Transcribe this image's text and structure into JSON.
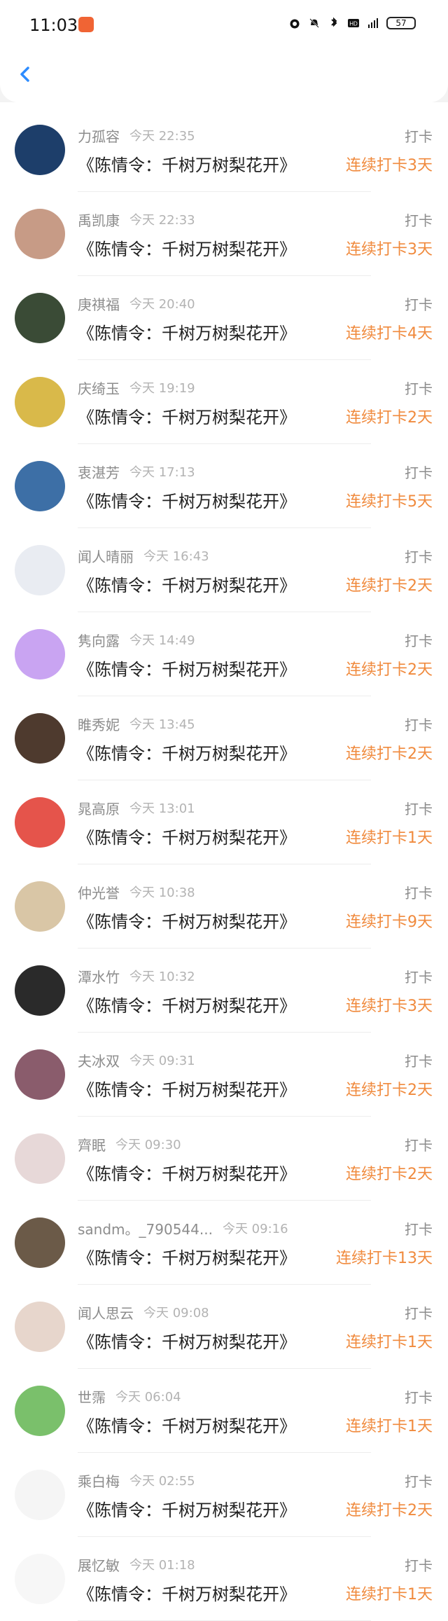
{
  "status_bar": {
    "time": "11:03",
    "battery": "57",
    "icons": [
      "alarm-icon",
      "bell-off-icon",
      "bluetooth-icon",
      "hd-icon",
      "5g-signal-icon",
      "battery-icon"
    ]
  },
  "nav": {
    "back_icon": "back-chevron-icon"
  },
  "rows": [
    {
      "name": "力孤容",
      "time": "今天 22:35",
      "title": "《陈情令：千树万树梨花开》",
      "action": "打卡",
      "streak": "连续打卡3天",
      "avatar_color": "#1d3e6a"
    },
    {
      "name": "禹凯康",
      "time": "今天 22:33",
      "title": "《陈情令：千树万树梨花开》",
      "action": "打卡",
      "streak": "连续打卡3天",
      "avatar_color": "#c79b86"
    },
    {
      "name": "庚祺福",
      "time": "今天 20:40",
      "title": "《陈情令：千树万树梨花开》",
      "action": "打卡",
      "streak": "连续打卡4天",
      "avatar_color": "#3a4b36"
    },
    {
      "name": "庆绮玉",
      "time": "今天 19:19",
      "title": "《陈情令：千树万树梨花开》",
      "action": "打卡",
      "streak": "连续打卡2天",
      "avatar_color": "#d9b94a"
    },
    {
      "name": "衷湛芳",
      "time": "今天 17:13",
      "title": "《陈情令：千树万树梨花开》",
      "action": "打卡",
      "streak": "连续打卡5天",
      "avatar_color": "#3d6fa6"
    },
    {
      "name": "闻人晴丽",
      "time": "今天 16:43",
      "title": "《陈情令：千树万树梨花开》",
      "action": "打卡",
      "streak": "连续打卡2天",
      "avatar_color": "#e9ecf2"
    },
    {
      "name": "隽向露",
      "time": "今天 14:49",
      "title": "《陈情令：千树万树梨花开》",
      "action": "打卡",
      "streak": "连续打卡2天",
      "avatar_color": "#c9a4f2"
    },
    {
      "name": "睢秀妮",
      "time": "今天 13:45",
      "title": "《陈情令：千树万树梨花开》",
      "action": "打卡",
      "streak": "连续打卡2天",
      "avatar_color": "#4e3a2e"
    },
    {
      "name": "晁高原",
      "time": "今天 13:01",
      "title": "《陈情令：千树万树梨花开》",
      "action": "打卡",
      "streak": "连续打卡1天",
      "avatar_color": "#e5544b"
    },
    {
      "name": "仲光誉",
      "time": "今天 10:38",
      "title": "《陈情令：千树万树梨花开》",
      "action": "打卡",
      "streak": "连续打卡9天",
      "avatar_color": "#d9c6a6"
    },
    {
      "name": "潭水竹",
      "time": "今天 10:32",
      "title": "《陈情令：千树万树梨花开》",
      "action": "打卡",
      "streak": "连续打卡3天",
      "avatar_color": "#2a2a2a"
    },
    {
      "name": "夫冰双",
      "time": "今天 09:31",
      "title": "《陈情令：千树万树梨花开》",
      "action": "打卡",
      "streak": "连续打卡2天",
      "avatar_color": "#8a5c6c"
    },
    {
      "name": "齊眠",
      "time": "今天 09:30",
      "title": "《陈情令：千树万树梨花开》",
      "action": "打卡",
      "streak": "连续打卡2天",
      "avatar_color": "#e7d8d8"
    },
    {
      "name": "sandm。_790544...",
      "time": "今天 09:16",
      "title": "《陈情令：千树万树梨花开》",
      "action": "打卡",
      "streak": "连续打卡13天",
      "avatar_color": "#6b5a48"
    },
    {
      "name": "闻人思云",
      "time": "今天 09:08",
      "title": "《陈情令：千树万树梨花开》",
      "action": "打卡",
      "streak": "连续打卡1天",
      "avatar_color": "#e7d6cc"
    },
    {
      "name": "世霈",
      "time": "今天 06:04",
      "title": "《陈情令：千树万树梨花开》",
      "action": "打卡",
      "streak": "连续打卡1天",
      "avatar_color": "#7ac06b"
    },
    {
      "name": "乘白梅",
      "time": "今天 02:55",
      "title": "《陈情令：千树万树梨花开》",
      "action": "打卡",
      "streak": "连续打卡2天",
      "avatar_color": "#f5f5f5"
    },
    {
      "name": "展忆敏",
      "time": "今天 01:18",
      "title": "《陈情令：千树万树梨花开》",
      "action": "打卡",
      "streak": "连续打卡1天",
      "avatar_color": "#f7f7f7"
    }
  ]
}
